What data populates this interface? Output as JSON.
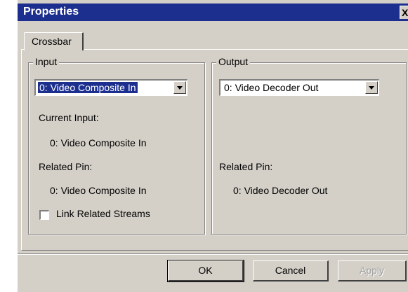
{
  "window": {
    "title": "Properties",
    "close_label": "X"
  },
  "tabs": [
    {
      "label": "Crossbar"
    }
  ],
  "input_group": {
    "title": "Input",
    "select_value": "0: Video Composite In",
    "current_input_label": "Current Input:",
    "current_input_value": "0: Video Composite In",
    "related_pin_label": "Related Pin:",
    "related_pin_value": "0: Video Composite In",
    "link_checkbox_label": "Link Related Streams",
    "link_checked": false
  },
  "output_group": {
    "title": "Output",
    "select_value": "0: Video Decoder Out",
    "related_pin_label": "Related Pin:",
    "related_pin_value": "0: Video Decoder Out"
  },
  "buttons": {
    "ok": "OK",
    "cancel": "Cancel",
    "apply": "Apply"
  }
}
